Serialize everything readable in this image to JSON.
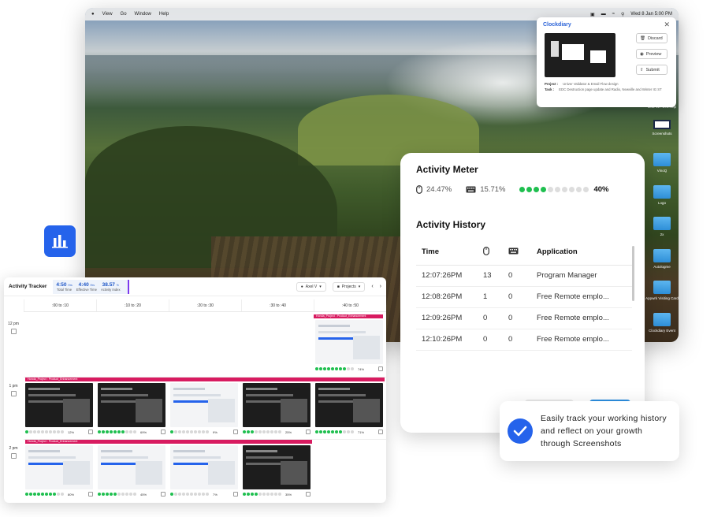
{
  "menubar": {
    "items": [
      "View",
      "Go",
      "Window",
      "Help"
    ],
    "clock": "Wed 8 Jan  5:00 PM"
  },
  "desktop_items": [
    {
      "label": "dl4d-42...b91.smp",
      "kind": "file"
    },
    {
      "label": "Screenshots",
      "kind": "screen"
    },
    {
      "label": "VinoQ",
      "kind": "folder"
    },
    {
      "label": "Logo",
      "kind": "folder"
    },
    {
      "label": "2x",
      "kind": "folder"
    },
    {
      "label": "Autologme",
      "kind": "folder"
    },
    {
      "label": "Appwrk Visiting Card",
      "kind": "folder"
    },
    {
      "label": "Clockdiary Event",
      "kind": "folder"
    }
  ],
  "clockdiary": {
    "title": "Clockdiary",
    "buttons": {
      "discard": "Discard",
      "preview": "Preview",
      "submit": "Submit"
    },
    "project_label": "Project :",
    "project_value": "Univer Validator & Email Flow design",
    "task_label": "Task :",
    "task_value": "EDC Destruction page update and Radio, Newville and Winter IG ST"
  },
  "activity_meter": {
    "title": "Activity Meter",
    "mouse_pct": "24.47%",
    "keyboard_pct": "15.71%",
    "level": 4,
    "level_max": 10,
    "level_text": "40%"
  },
  "activity_history": {
    "title": "Activity History",
    "columns": [
      "Time",
      "mouse-icon",
      "keyboard-icon",
      "Application"
    ],
    "rows": [
      {
        "time": "12:07:26PM",
        "mouse": "13",
        "keys": "0",
        "app": "Program Manager"
      },
      {
        "time": "12:08:26PM",
        "mouse": "1",
        "keys": "0",
        "app": "Free Remote emplo..."
      },
      {
        "time": "12:09:26PM",
        "mouse": "0",
        "keys": "0",
        "app": "Free Remote emplo..."
      },
      {
        "time": "12:10:26PM",
        "mouse": "0",
        "keys": "0",
        "app": "Free Remote emplo..."
      }
    ]
  },
  "toast": {
    "text": "Easily track your working history and reflect on your growth through Screenshots",
    "accent": "#2563eb"
  },
  "tracker": {
    "title": "Activity Tracker",
    "total_time": "4:50",
    "total_unit": "Hrs",
    "total_label": "Total Time",
    "effective_time": "4:40",
    "effective_unit": "Hrs",
    "effective_label": "Effective Time",
    "index": "38.57",
    "index_unit": "%",
    "index_label": "Activity Index",
    "user": "Axel V",
    "projects": "Projects",
    "columns": [
      ":00 to :10",
      ":10 to :20",
      ":20 to :30",
      ":30 to :40",
      ":40 to :50"
    ],
    "rows": [
      {
        "label": "12 pm",
        "project": "Honda_Project : Product_Enhancement"
      },
      {
        "label": "1 pm",
        "project": "Honda_Project : Product_Enhancement"
      },
      {
        "label": "2 pm",
        "project": "Honda_Project : Product_Enhancement"
      }
    ],
    "shots": [
      {
        "row": 0,
        "col": 4,
        "pct": "74%",
        "level": 8,
        "theme": "light"
      },
      {
        "row": 1,
        "col": 0,
        "pct": "12%",
        "level": 1,
        "theme": "dark"
      },
      {
        "row": 1,
        "col": 1,
        "pct": "69%",
        "level": 7,
        "theme": "dark"
      },
      {
        "row": 1,
        "col": 2,
        "pct": "9%",
        "level": 1,
        "theme": "light"
      },
      {
        "row": 1,
        "col": 3,
        "pct": "25%",
        "level": 3,
        "theme": "dark"
      },
      {
        "row": 1,
        "col": 4,
        "pct": "71%",
        "level": 7,
        "theme": "dark"
      },
      {
        "row": 2,
        "col": 0,
        "pct": "80%",
        "level": 8,
        "theme": "light"
      },
      {
        "row": 2,
        "col": 1,
        "pct": "45%",
        "level": 5,
        "theme": "light"
      },
      {
        "row": 2,
        "col": 2,
        "pct": "7%",
        "level": 1,
        "theme": "light"
      },
      {
        "row": 2,
        "col": 3,
        "pct": "35%",
        "level": 4,
        "theme": "dark"
      }
    ]
  },
  "colors": {
    "accent": "#2563eb",
    "green": "#1fbf4f",
    "project_bar": "#d81b60"
  }
}
